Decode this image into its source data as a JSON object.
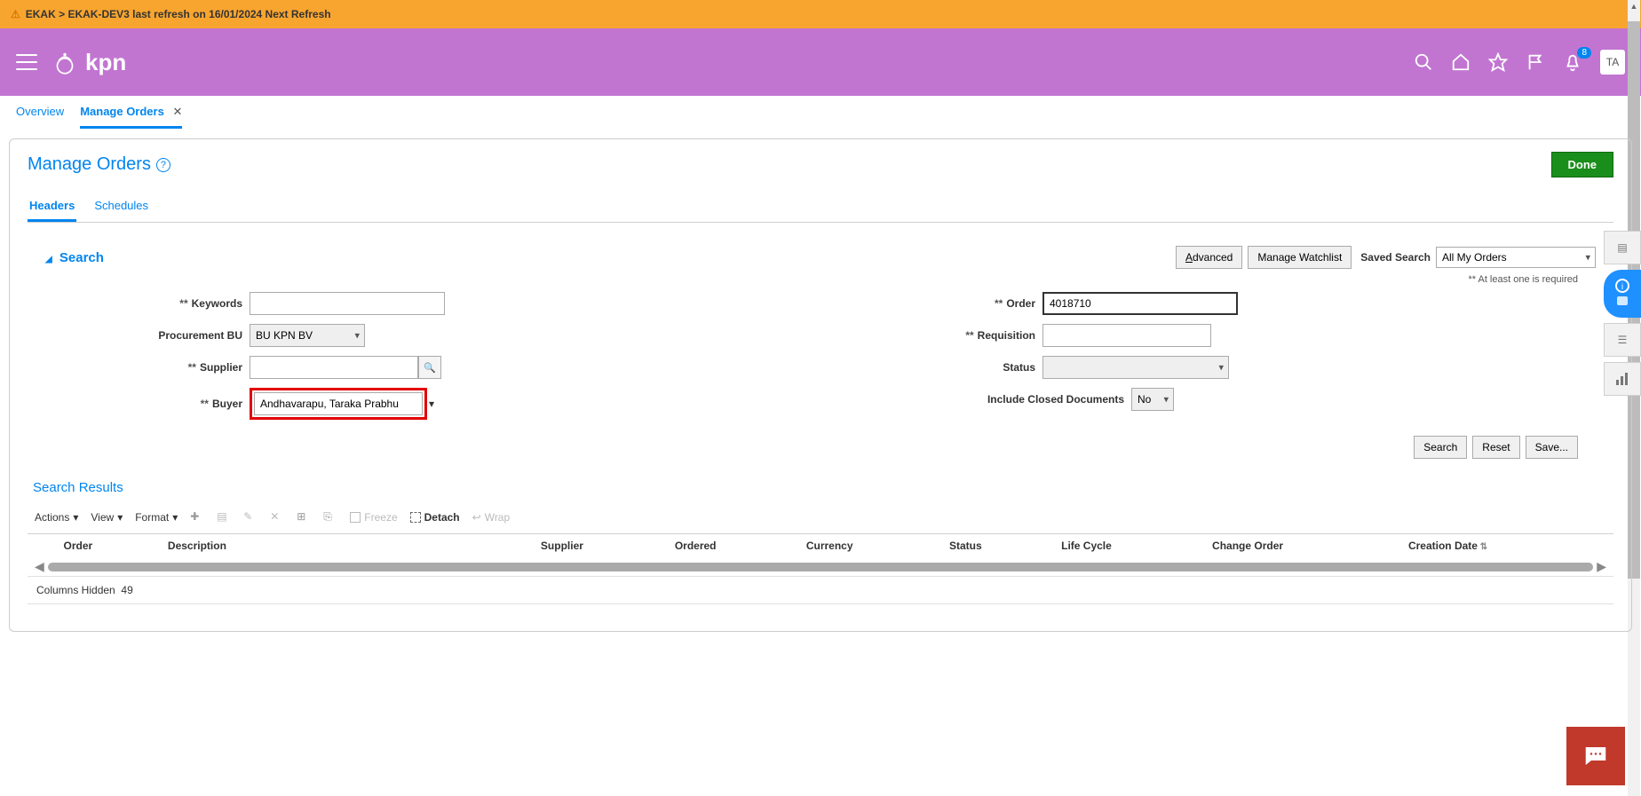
{
  "top_bar": {
    "text": "EKAK > EKAK-DEV3 last refresh on 16/01/2024 Next Refresh"
  },
  "header": {
    "brand": "kpn",
    "avatar": "TA",
    "notification_badge": "8"
  },
  "nav_tabs": {
    "overview": "Overview",
    "manage_orders": "Manage Orders"
  },
  "page": {
    "title": "Manage Orders",
    "done": "Done"
  },
  "subtabs": {
    "headers": "Headers",
    "schedules": "Schedules"
  },
  "search": {
    "title": "Search",
    "advanced_u": "A",
    "advanced_rest": "dvanced",
    "manage_watchlist": "Manage Watchlist",
    "saved_search_label": "Saved Search",
    "saved_search_value": "All My Orders",
    "required_note": "** At least one is required",
    "labels": {
      "keywords": "Keywords",
      "procurement_bu": "Procurement BU",
      "supplier": "Supplier",
      "buyer": "Buyer",
      "order": "Order",
      "requisition": "Requisition",
      "status": "Status",
      "include_closed": "Include Closed Documents"
    },
    "values": {
      "keywords": "",
      "procurement_bu": "BU KPN BV",
      "supplier": "",
      "buyer": "Andhavarapu, Taraka Prabhu",
      "order": "4018710",
      "requisition": "",
      "status": "",
      "include_closed": "No"
    },
    "buttons": {
      "search": "Search",
      "reset": "Reset",
      "save": "Save..."
    }
  },
  "results": {
    "title": "Search Results",
    "toolbar": {
      "actions": "Actions",
      "view": "View",
      "format": "Format",
      "freeze": "Freeze",
      "detach": "Detach",
      "wrap": "Wrap"
    },
    "columns": [
      "Order",
      "Description",
      "Supplier",
      "Ordered",
      "Currency",
      "Status",
      "Life Cycle",
      "Change Order",
      "Creation Date"
    ],
    "columns_hidden_label": "Columns Hidden",
    "columns_hidden_count": "49"
  }
}
